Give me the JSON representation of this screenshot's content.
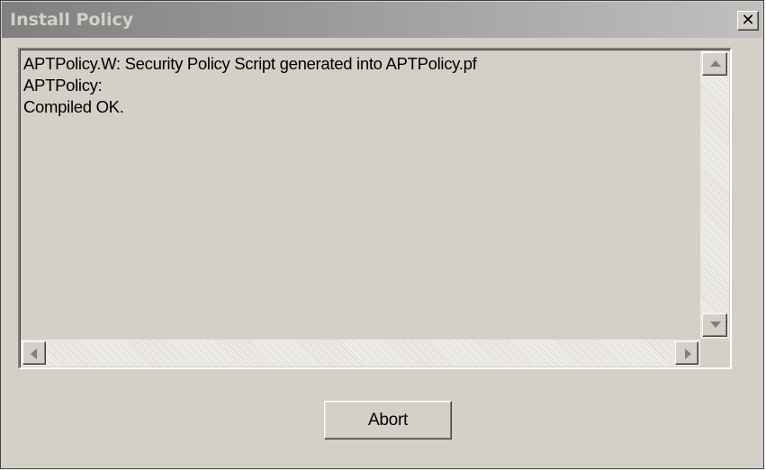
{
  "window": {
    "title": "Install Policy",
    "close_icon": "close-icon (×)"
  },
  "log": {
    "lines": [
      "APTPolicy.W: Security Policy Script generated into APTPolicy.pf",
      "APTPolicy:",
      "Compiled OK."
    ]
  },
  "scrollbars": {
    "vertical": {
      "up_icon": "arrow-up-icon",
      "down_icon": "arrow-down-icon",
      "enabled": false
    },
    "horizontal": {
      "left_icon": "arrow-left-icon",
      "right_icon": "arrow-right-icon",
      "enabled": false
    }
  },
  "buttons": {
    "abort_label": "Abort"
  },
  "colors": {
    "face": "#d4d0c8",
    "title_gradient_start": "#808080",
    "title_gradient_end": "#c0c0c0",
    "title_text": "#d4d0c8",
    "disabled_arrow": "#808080"
  }
}
